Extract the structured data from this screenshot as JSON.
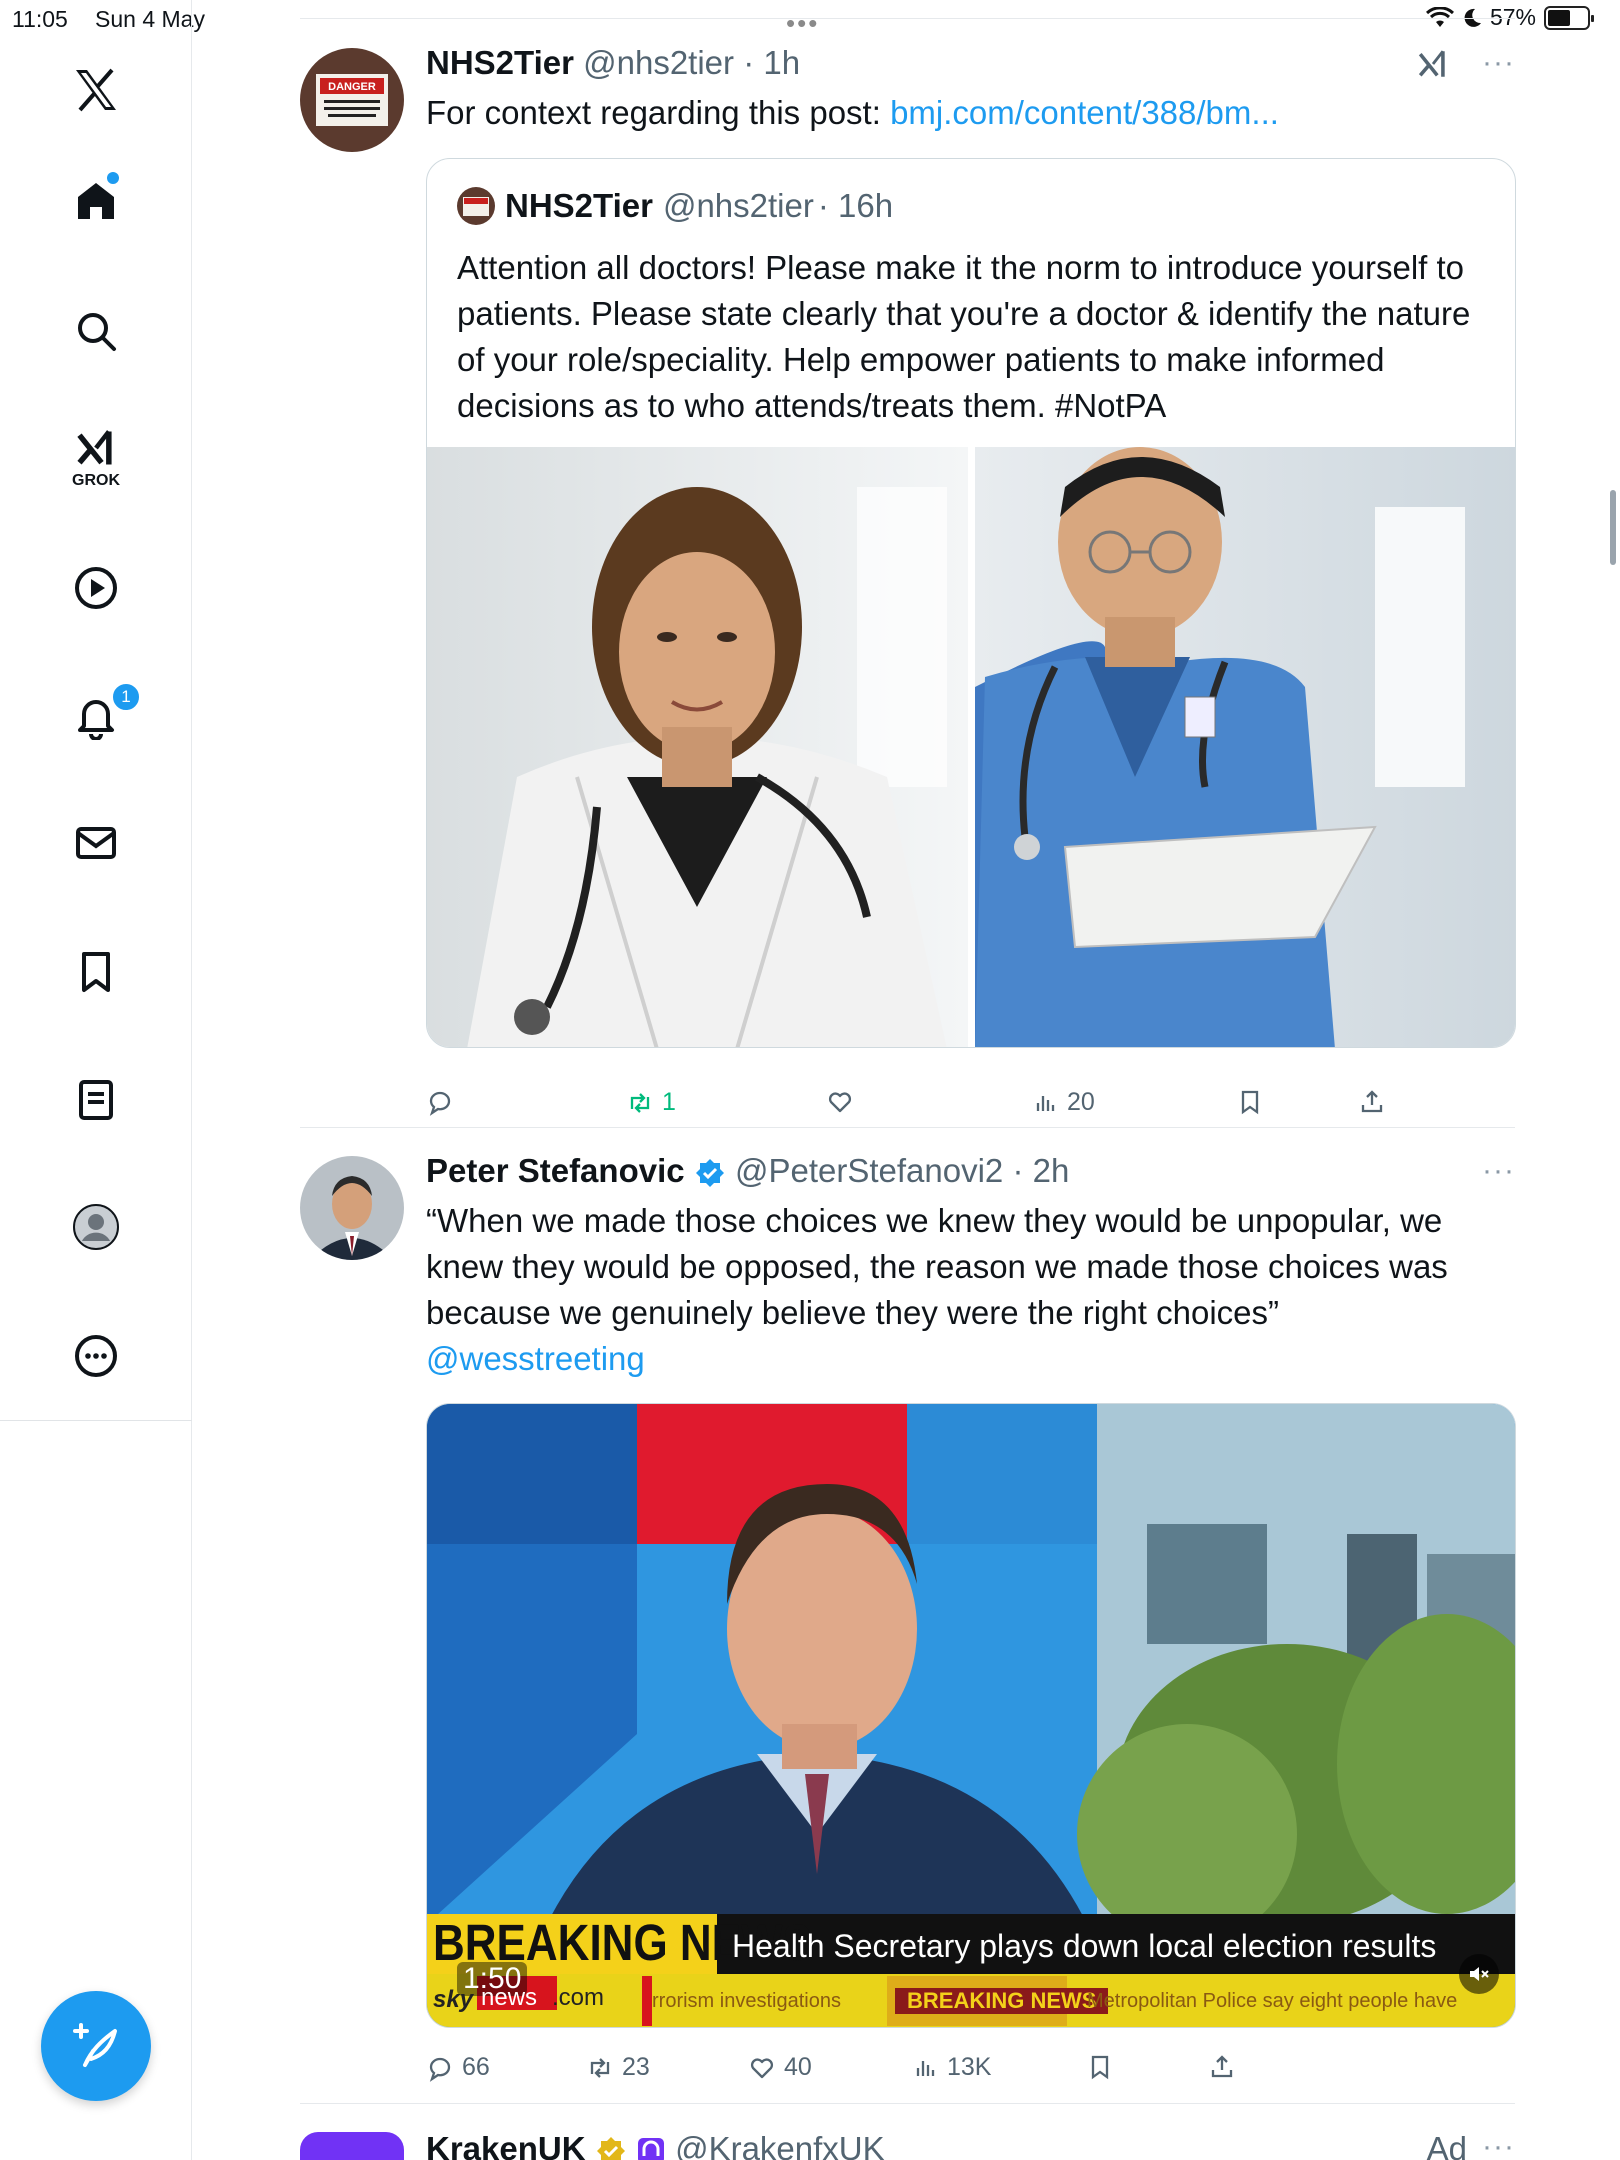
{
  "status": {
    "time": "11:05",
    "date": "Sun 4 May",
    "battery": "57%",
    "battery_fraction": 0.57
  },
  "sidebar": {
    "items": [
      {
        "label": "",
        "icon": "x-logo-icon"
      },
      {
        "label": "",
        "icon": "home-icon"
      },
      {
        "label": "",
        "icon": "search-icon"
      },
      {
        "label": "GROK",
        "icon": "grok-icon"
      },
      {
        "label": "",
        "icon": "video-play-icon"
      },
      {
        "label": "",
        "icon": "bell-icon"
      },
      {
        "label": "",
        "icon": "mail-icon"
      },
      {
        "label": "",
        "icon": "bookmark-icon"
      },
      {
        "label": "",
        "icon": "list-icon"
      },
      {
        "label": "",
        "icon": "profile-icon"
      },
      {
        "label": "",
        "icon": "more-circle-icon"
      }
    ],
    "notification_count": "1",
    "compose_icon": "compose-plus-icon"
  },
  "tweets": [
    {
      "name": "NHS2Tier",
      "handle": "@nhs2tier",
      "time": "· 1h",
      "text": "For context regarding this post: ",
      "link": "bmj.com/content/388/bm...",
      "avatar_text": "DANGER",
      "quote": {
        "name": "NHS2Tier",
        "handle": "@nhs2tier",
        "time": "· 16h",
        "text": "Attention all doctors! Please make it the norm to introduce yourself to patients. Please state clearly that you're a doctor & identify the nature of your role/speciality. Help empower patients to make informed decisions as to who attends/treats them. #NotPA"
      },
      "actions": {
        "replies": "",
        "reposts": "1",
        "likes": "",
        "views": "20"
      }
    },
    {
      "name": "Peter Stefanovic",
      "handle": "@PeterStefanovi2",
      "time": "· 2h",
      "text": "“When we made those choices we knew they would be unpopular, we knew they would be opposed, the reason we made those choices was because we genuinely believe they were the right choices”",
      "mention": "@wesstreeting",
      "video": {
        "breaking_label": "BREAKING NEWS",
        "headline": "Health Secretary plays down local election results",
        "duration": "1:50",
        "sky_brand": "sky",
        "news_brand": "news",
        "domain_suffix": ".com",
        "ticker_1": "rrorism investigations",
        "ticker_2": "BREAKING NEWS",
        "ticker_3": "Metropolitan Police say eight people have"
      },
      "actions": {
        "replies": "66",
        "reposts": "23",
        "likes": "40",
        "views": "13K"
      }
    },
    {
      "name": "KrakenUK",
      "handle": "@KrakenfxUK",
      "ad": "Ad"
    }
  ],
  "colors": {
    "accent": "#1d9bf0",
    "text": "#0f1419",
    "secondary": "#536471",
    "repost_green": "#00ba7c",
    "kraken_purple": "#7132f5",
    "gold_badge": "#e2b719"
  }
}
